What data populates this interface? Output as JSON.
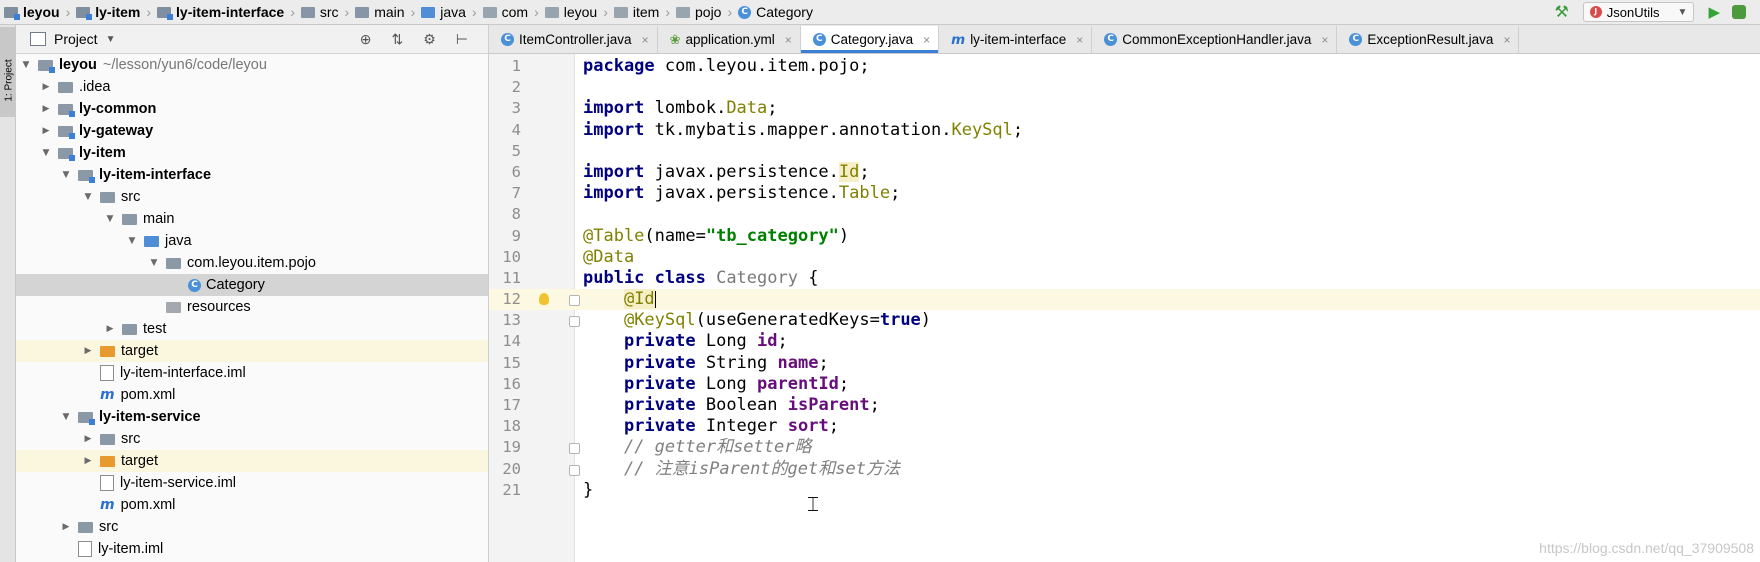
{
  "breadcrumbs": [
    "leyou",
    "ly-item",
    "ly-item-interface",
    "src",
    "main",
    "java",
    "com",
    "leyou",
    "item",
    "pojo",
    "Category"
  ],
  "run_config": "JsonUtils",
  "side_tab": "1: Project",
  "project_panel": {
    "title": "Project"
  },
  "tree": [
    {
      "label": "leyou",
      "path": "~/lesson/yun6/code/leyou"
    },
    {
      "label": ".idea"
    },
    {
      "label": "ly-common"
    },
    {
      "label": "ly-gateway"
    },
    {
      "label": "ly-item"
    },
    {
      "label": "ly-item-interface"
    },
    {
      "label": "src"
    },
    {
      "label": "main"
    },
    {
      "label": "java"
    },
    {
      "label": "com.leyou.item.pojo"
    },
    {
      "label": "Category"
    },
    {
      "label": "resources"
    },
    {
      "label": "test"
    },
    {
      "label": "target"
    },
    {
      "label": "ly-item-interface.iml"
    },
    {
      "label": "pom.xml"
    },
    {
      "label": "ly-item-service"
    },
    {
      "label": "src"
    },
    {
      "label": "target"
    },
    {
      "label": "ly-item-service.iml"
    },
    {
      "label": "pom.xml"
    },
    {
      "label": "src"
    },
    {
      "label": "ly-item.iml"
    }
  ],
  "tabs": [
    "ItemController.java",
    "application.yml",
    "Category.java",
    "ly-item-interface",
    "CommonExceptionHandler.java",
    "ExceptionResult.java"
  ],
  "editor": {
    "line_numbers": [
      "1",
      "2",
      "3",
      "4",
      "5",
      "6",
      "7",
      "8",
      "9",
      "10",
      "11",
      "12",
      "13",
      "14",
      "15",
      "16",
      "17",
      "18",
      "19",
      "20",
      "21"
    ],
    "t": {
      "package": "package",
      "pkg_name": " com.leyou.item.pojo;",
      "import": "import",
      "imp_lombok": " lombok.",
      "data_word": "Data",
      "imp_tk": " tk.mybatis.mapper.annotation.",
      "keysql_word": "KeySql",
      "imp_javax": " javax.persistence.",
      "id_word": "Id",
      "table_word": "Table",
      "semi": ";",
      "at_table": "@Table",
      "name_open": "(name=",
      "table_name": "\"tb_category\"",
      "paren_close": ")",
      "at_data": "@Data",
      "public": "public",
      "class": " class",
      "class_name": " Category",
      "brace_open": " {",
      "indent": "    ",
      "at_id": "@Id",
      "at_keysql": "@KeySql",
      "use_gen": "(useGeneratedKeys=",
      "true_word": "true",
      "private": "private",
      "type_long": " Long ",
      "type_string": " String ",
      "type_boolean": " Boolean ",
      "type_integer": " Integer ",
      "f_id": "id",
      "f_name": "name",
      "f_parentId": "parentId",
      "f_isParent": "isParent",
      "f_sort": "sort",
      "comment1": "// getter和setter略",
      "comment2": "// 注意isParent的get和set方法",
      "brace_close": "}"
    }
  },
  "watermark": "https://blog.csdn.net/qq_37909508",
  "colors": {
    "keyword": "#000080",
    "annotation": "#808000",
    "string": "#008000",
    "field": "#660e7a",
    "comment": "#808080",
    "accent": "#3b7fd6"
  }
}
